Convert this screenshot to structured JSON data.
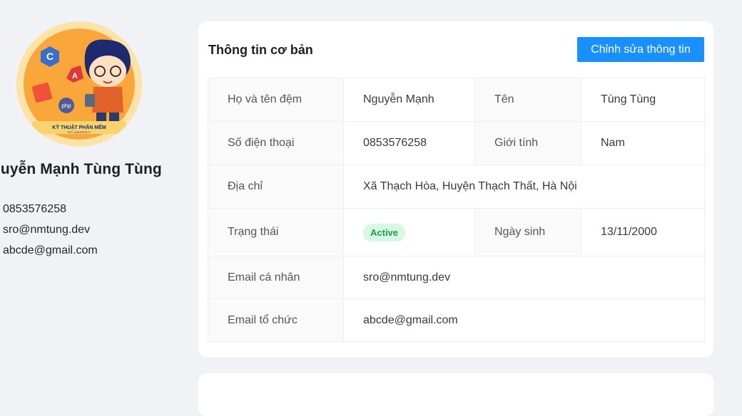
{
  "profile": {
    "name": "guyễn Mạnh Tùng Tùng",
    "phone": "0853576258",
    "email_personal": "sro@nmtung.dev",
    "email_org": "abcde@gmail.com",
    "avatar_caption": "KỸ THUẬT PHẦN MỀM",
    "avatar_subcaption": "FPT UNIVERSITY"
  },
  "card": {
    "title": "Thông tin cơ bản",
    "edit_label": "Chỉnh sửa thông tin",
    "rows": {
      "fullname_label": "Họ và tên đệm",
      "fullname_value": "Nguyễn Mạnh",
      "firstname_label": "Tên",
      "firstname_value": "Tùng Tùng",
      "phone_label": "Số điện thoại",
      "phone_value": "0853576258",
      "gender_label": "Giới tính",
      "gender_value": "Nam",
      "address_label": "Địa chỉ",
      "address_value": "Xã Thạch Hòa, Huyện Thạch Thất, Hà Nội",
      "status_label": "Trạng thái",
      "status_value": "Active",
      "dob_label": "Ngày sinh",
      "dob_value": "13/11/2000",
      "email_personal_label": "Email cá nhân",
      "email_personal_value": "sro@nmtung.dev",
      "email_org_label": "Email tổ chức",
      "email_org_value": "abcde@gmail.com"
    }
  },
  "colors": {
    "accent": "#1890ff",
    "status_bg": "#d9f7e3",
    "status_text": "#16a34a",
    "page_bg": "#f0f2f5"
  }
}
